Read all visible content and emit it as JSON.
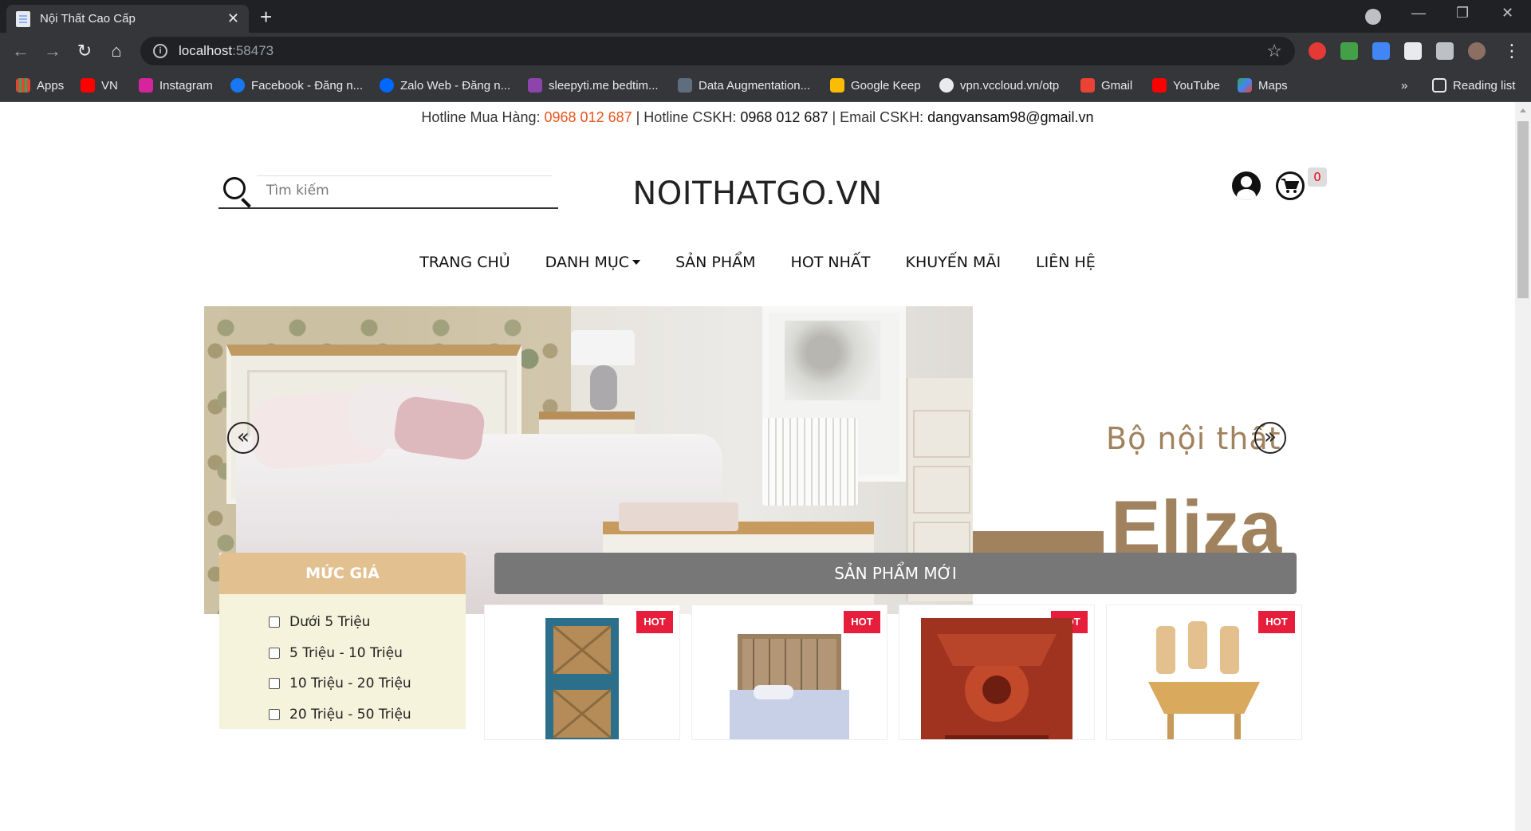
{
  "browser": {
    "tab_title": "Nội Thất Cao Cấp",
    "url_host": "localhost",
    "url_port": ":58473",
    "bookmarks": [
      {
        "label": "Apps",
        "icon": "apps-grid-icon",
        "color": "#e8eaed"
      },
      {
        "label": "VN",
        "icon": "youtube-icon",
        "color": "#ff0000"
      },
      {
        "label": "Instagram",
        "icon": "instagram-icon",
        "color": "#d6249f"
      },
      {
        "label": "Facebook - Đăng n...",
        "icon": "facebook-icon",
        "color": "#1877f2"
      },
      {
        "label": "Zalo Web - Đăng n...",
        "icon": "zalo-icon",
        "color": "#0068ff"
      },
      {
        "label": "sleepyti.me bedtim...",
        "icon": "sleepytime-icon",
        "color": "#8e44ad"
      },
      {
        "label": "Data Augmentation...",
        "icon": "page-icon",
        "color": "#5f6d7e"
      },
      {
        "label": "Google Keep",
        "icon": "google-keep-icon",
        "color": "#fbbc04"
      },
      {
        "label": "vpn.vccloud.vn/otp",
        "icon": "globe-icon",
        "color": "#e8eaed"
      },
      {
        "label": "Gmail",
        "icon": "gmail-icon",
        "color": "#ea4335"
      },
      {
        "label": "YouTube",
        "icon": "youtube-icon",
        "color": "#ff0000"
      },
      {
        "label": "Maps",
        "icon": "maps-icon",
        "color": "#34a853"
      }
    ],
    "more_bookmarks": "»",
    "reading_list": "Reading list"
  },
  "topbar": {
    "hotline_buy_label": "Hotline Mua Hàng: ",
    "hotline_buy_number": "0968 012 687",
    "hotline_care_label": " | Hotline CSKH: ",
    "hotline_care_number": "0968 012 687",
    "email_label": " | Email CSKH: ",
    "email": "dangvansam98@gmail.vn"
  },
  "header": {
    "search_placeholder": "Tìm kiếm",
    "logo": "NOITHATGO.VN",
    "cart_count": "0"
  },
  "nav": {
    "home": "TRANG CHỦ",
    "categories": "DANH MỤC",
    "products": "SẢN PHẨM",
    "hottest": "HOT NHẤT",
    "promotions": "KHUYẾN MÃI",
    "contact": "LIÊN HỆ"
  },
  "banner": {
    "tagline": "Bộ nội thất",
    "brand": "Eliza",
    "prev_symbol": "«",
    "next_symbol": "»",
    "accent_color": "#a0825f"
  },
  "filter": {
    "title": "MỨC GIÁ",
    "options": [
      "Dưới 5 Triệu",
      "5 Triệu - 10 Triệu",
      "10 Triệu - 20 Triệu",
      "20 Triệu - 50 Triệu"
    ]
  },
  "products": {
    "section_title": "SẢN PHẨM MỚI",
    "badge": "HOT",
    "items": [
      {
        "image": "blue-shelf-with-baskets"
      },
      {
        "image": "wooden-bed-with-white-linen"
      },
      {
        "image": "carved-red-wood-panel"
      },
      {
        "image": "wooden-dining-table-set"
      }
    ]
  }
}
